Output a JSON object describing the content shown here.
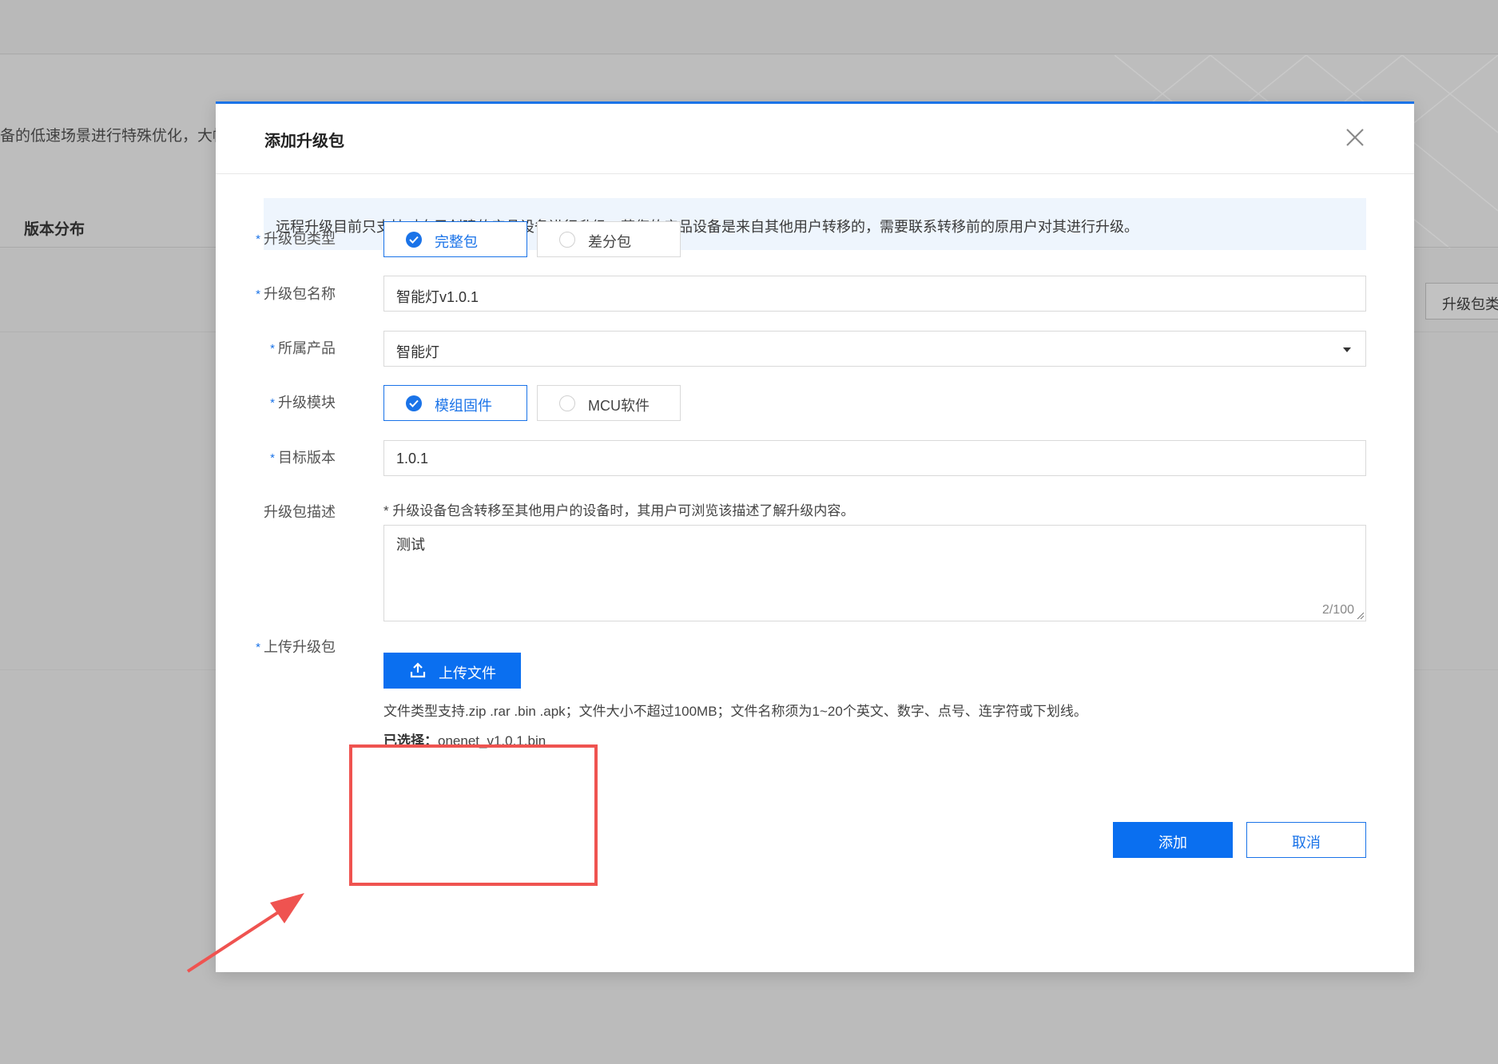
{
  "background": {
    "banner_text": "备的低速场景进行特殊优化，大幅提",
    "tab_label": "版本分布",
    "filter_label": "升级包类"
  },
  "dialog": {
    "title": "添加升级包",
    "notice": "远程升级目前只支持对自己创建的产品设备进行升级，若您的产品设备是来自其他用户转移的，需要联系转移前的原用户对其进行升级。",
    "required_mark": "*",
    "fields": {
      "package_type": {
        "label": "升级包类型",
        "options": [
          "完整包",
          "差分包"
        ],
        "selected": "完整包"
      },
      "package_name": {
        "label": "升级包名称",
        "value": "智能灯v1.0.1"
      },
      "product": {
        "label": "所属产品",
        "value": "智能灯"
      },
      "module": {
        "label": "升级模块",
        "options": [
          "模组固件",
          "MCU软件"
        ],
        "selected": "模组固件"
      },
      "target_version": {
        "label": "目标版本",
        "value": "1.0.1"
      },
      "description": {
        "label": "升级包描述",
        "hint": "* 升级设备包含转移至其他用户的设备时，其用户可浏览该描述了解升级内容。",
        "value": "测试",
        "counter": "2/100"
      },
      "upload": {
        "label": "上传升级包",
        "button_label": "上传文件",
        "hint": "文件类型支持.zip .rar .bin .apk；文件大小不超过100MB；文件名称须为1~20个英文、数字、点号、连字符或下划线。",
        "selected_label": "已选择：",
        "selected_file": "onenet_v1.0.1.bin"
      }
    },
    "buttons": {
      "confirm": "添加",
      "cancel": "取消"
    }
  },
  "colors": {
    "accent": "#1a73e8",
    "primary_button": "#0a6ff0",
    "annotation": "#ef5350",
    "notice_bg": "#eef5fd"
  },
  "icons": {
    "close": "close-icon",
    "check": "check-icon",
    "upload": "upload-icon",
    "dropdown": "caret-down-icon"
  }
}
